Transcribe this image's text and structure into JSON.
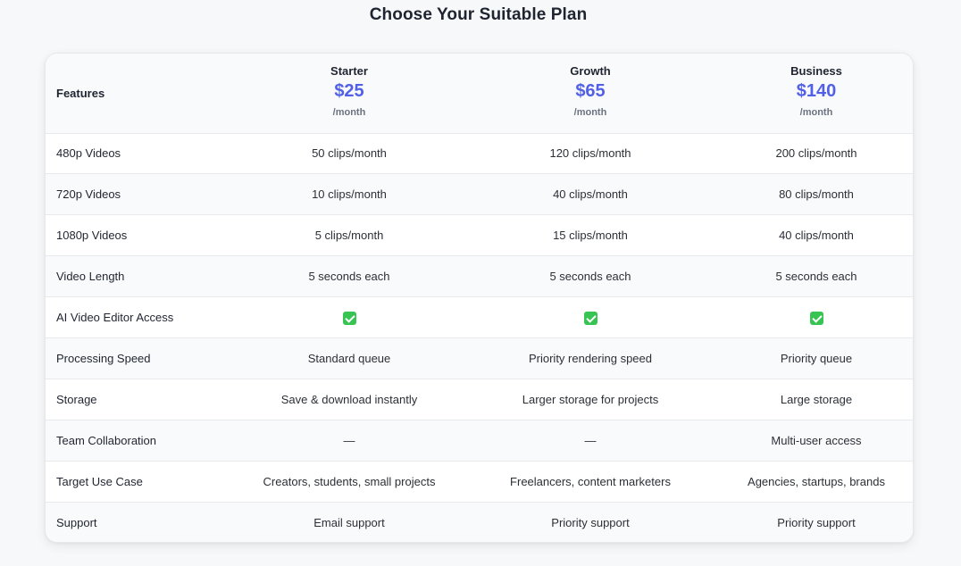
{
  "title": "Choose Your Suitable Plan",
  "header": {
    "features_label": "Features",
    "plans": [
      {
        "name": "Starter",
        "price": "$25",
        "period": "/month"
      },
      {
        "name": "Growth",
        "price": "$65",
        "period": "/month"
      },
      {
        "name": "Business",
        "price": "$140",
        "period": "/month"
      }
    ]
  },
  "rows": [
    {
      "feature": "480p Videos",
      "values": [
        "50 clips/month",
        "120 clips/month",
        "200 clips/month"
      ]
    },
    {
      "feature": "720p Videos",
      "values": [
        "10 clips/month",
        "40 clips/month",
        "80 clips/month"
      ]
    },
    {
      "feature": "1080p Videos",
      "values": [
        "5 clips/month",
        "15 clips/month",
        "40 clips/month"
      ]
    },
    {
      "feature": "Video Length",
      "values": [
        "5 seconds each",
        "5 seconds each",
        "5 seconds each"
      ]
    },
    {
      "feature": "AI Video Editor Access",
      "values": [
        "check-icon",
        "check-icon",
        "check-icon"
      ]
    },
    {
      "feature": "Processing Speed",
      "values": [
        "Standard queue",
        "Priority rendering speed",
        "Priority queue"
      ]
    },
    {
      "feature": "Storage",
      "values": [
        "Save & download instantly",
        "Larger storage for projects",
        "Large storage"
      ]
    },
    {
      "feature": "Team Collaboration",
      "values": [
        "—",
        "—",
        "Multi-user access"
      ]
    },
    {
      "feature": "Target Use Case",
      "values": [
        "Creators, students, small projects",
        "Freelancers, content marketers",
        "Agencies, startups, brands"
      ]
    },
    {
      "feature": "Support",
      "values": [
        "Email support",
        "Priority support",
        "Priority support"
      ]
    }
  ],
  "colors": {
    "accent": "#5160e6",
    "check": "#37c453",
    "background": "#f7f8fa"
  }
}
